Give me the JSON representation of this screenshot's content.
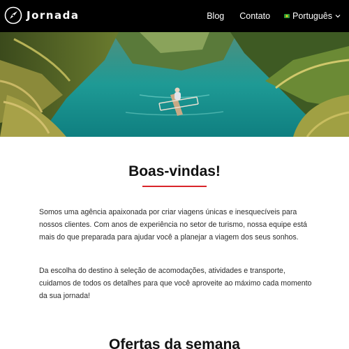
{
  "header": {
    "brand_name": "Jornada",
    "nav": {
      "blog_label": "Blog",
      "contact_label": "Contato",
      "language_label": "Português"
    }
  },
  "hero": {
    "image": "person-in-canoe-on-tropical-river"
  },
  "welcome": {
    "title": "Boas-vindas!",
    "paragraph_1": "Somos uma agência apaixonada por criar viagens únicas e inesquecíveis para nossos clientes. Com anos de experiência no setor de turismo, nossa equipe está mais do que preparada para ajudar você a planejar a viagem dos seus sonhos.",
    "paragraph_2": "Da escolha do destino à seleção de acomodações, atividades e transporte, cuidamos de todos os detalhes para que você aproveite ao máximo cada momento da sua jornada!"
  },
  "offers": {
    "title": "Ofertas da semana"
  },
  "colors": {
    "navbar_bg": "#000000",
    "accent_red": "#d9252a",
    "text_dark": "#111111",
    "flag_green": "#2e9a36"
  }
}
